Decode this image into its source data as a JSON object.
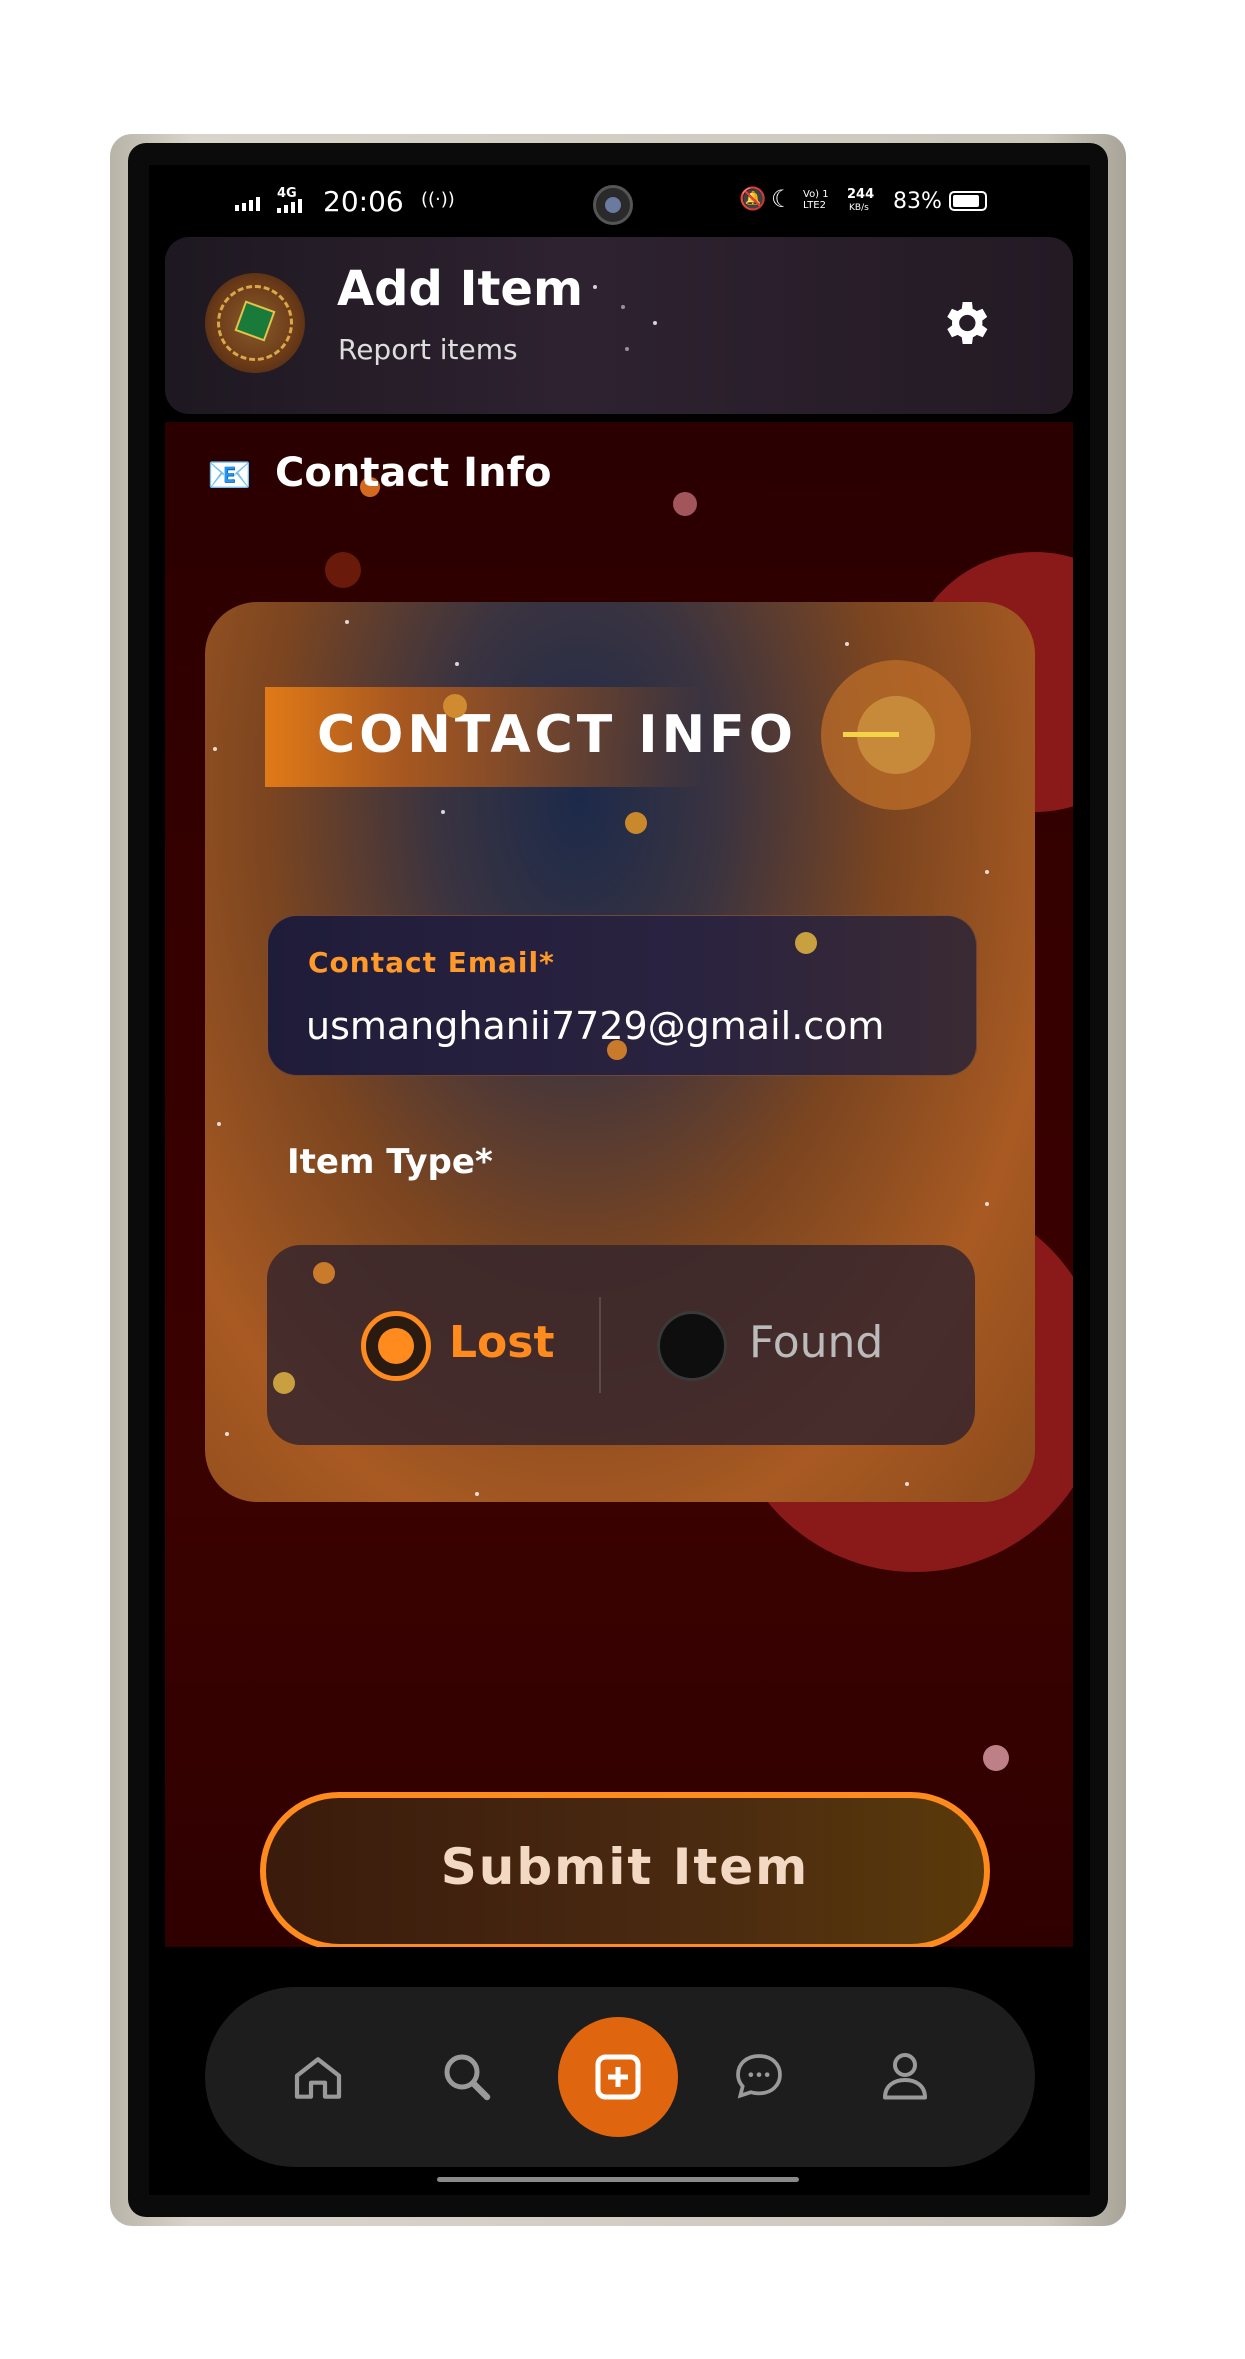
{
  "status_bar": {
    "network": "4G",
    "time": "20:06",
    "volte": "Vo) 1 LTE2",
    "speed_value": "244",
    "speed_unit": "KB/s",
    "battery": "83%"
  },
  "header": {
    "title": "Add Item",
    "subtitle": "Report items",
    "logo_icon": "leaf-crest-logo",
    "settings_icon": "gear-icon"
  },
  "section": {
    "emoji_icon": "email-icon",
    "title": "Contact Info"
  },
  "card": {
    "banner_title": "CONTACT INFO",
    "email_field": {
      "label": "Contact Email*",
      "value": "usmanghanii7729@gmail.com"
    },
    "item_type_label": "Item Type*",
    "options": [
      {
        "label": "Lost",
        "selected": true
      },
      {
        "label": "Found",
        "selected": false
      }
    ]
  },
  "submit_label": "Submit Item",
  "bottom_nav": [
    {
      "name": "home",
      "icon": "home-icon"
    },
    {
      "name": "search",
      "icon": "search-icon"
    },
    {
      "name": "add",
      "icon": "add-icon",
      "active": true
    },
    {
      "name": "chat",
      "icon": "chat-icon"
    },
    {
      "name": "profile",
      "icon": "profile-icon"
    }
  ],
  "colors": {
    "accent": "#ff8a1e",
    "active_nav": "#e0650f",
    "content_bg": "#360000"
  }
}
